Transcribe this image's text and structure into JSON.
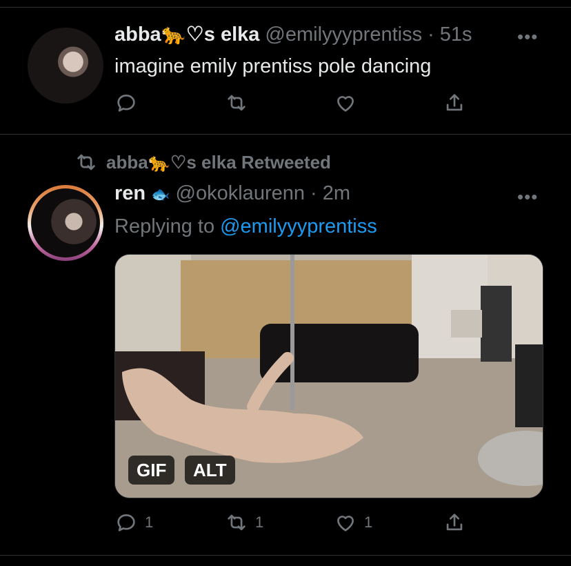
{
  "tweet1": {
    "display_name": "abba🐆♡s elka",
    "handle": "@emilyyyprentiss",
    "time": "· 51s",
    "text": "imagine emily prentiss pole dancing",
    "more": "•••"
  },
  "retweet_label": "abba🐆♡s elka Retweeted",
  "tweet2": {
    "display_name": "ren",
    "name_icon": "🐟",
    "handle": "@okoklaurenn",
    "time": "· 2m",
    "replying_prefix": "Replying to",
    "replying_to": "@emilyyyprentiss",
    "more": "•••",
    "media": {
      "badge_gif": "GIF",
      "badge_alt": "ALT"
    },
    "counts": {
      "replies": "1",
      "retweets": "1",
      "likes": "1"
    }
  },
  "icons": [
    "reply-icon",
    "retweet-icon",
    "like-icon",
    "share-icon",
    "more-icon"
  ],
  "colors": {
    "background": "#000000",
    "text": "#e7e9ea",
    "muted": "#71767b",
    "link": "#1d9bf0",
    "divider": "#2f3336"
  }
}
